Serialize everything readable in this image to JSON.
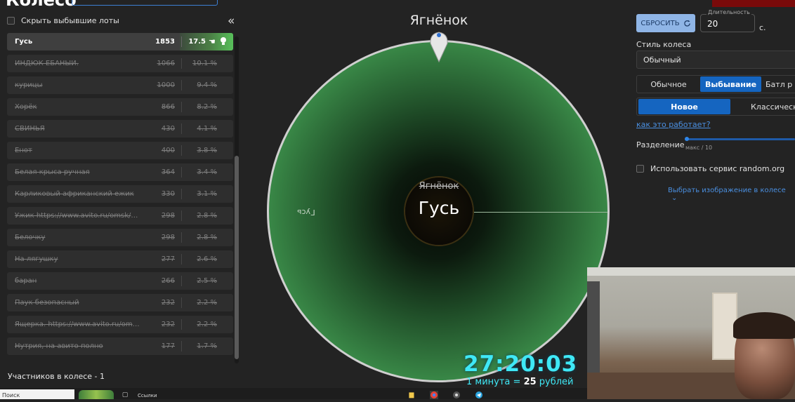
{
  "header": {
    "title": "Колесо"
  },
  "lots_panel": {
    "hide_eliminated_label": "Скрыть выбывшие лоты",
    "collapse_icon": "double-chevron-left-icon",
    "items": [
      {
        "name": "Гусь",
        "amount": "1853",
        "percent": "17.5",
        "active": true
      },
      {
        "name": "ИНДЮК ЁБАНЫЙ.",
        "amount": "1066",
        "percent": "10.1 %"
      },
      {
        "name": "курицы",
        "amount": "1000",
        "percent": "9.4 %"
      },
      {
        "name": "Хорёк",
        "amount": "866",
        "percent": "8.2 %"
      },
      {
        "name": "СВИНЬЯ",
        "amount": "430",
        "percent": "4.1 %"
      },
      {
        "name": "Енот",
        "amount": "400",
        "percent": "3.8 %"
      },
      {
        "name": "Белая крыса ручная",
        "amount": "364",
        "percent": "3.4 %"
      },
      {
        "name": "Карликовый африканский ежик",
        "amount": "330",
        "percent": "3.1 %"
      },
      {
        "name": "Ужик https://www.avito.ru/omsk/dru...",
        "amount": "298",
        "percent": "2.8 %"
      },
      {
        "name": "Белочку",
        "amount": "298",
        "percent": "2.8 %"
      },
      {
        "name": "На лягушку",
        "amount": "277",
        "percent": "2.6 %"
      },
      {
        "name": "баран",
        "amount": "266",
        "percent": "2.5 %"
      },
      {
        "name": "Паук безопасный",
        "amount": "232",
        "percent": "2.2 %"
      },
      {
        "name": "Ящерка. https://www.avito.ru/omsk/...",
        "amount": "232",
        "percent": "2.2 %"
      },
      {
        "name": "Нутрия, на авито полно",
        "amount": "177",
        "percent": "1.7 %"
      }
    ],
    "participants_label": "Участников в колесе - 1"
  },
  "wheel": {
    "winner_top": "Ягнёнок",
    "center_previous": "Ягнёнок",
    "center_current": "Гусь",
    "slice_label": "Гусь",
    "colors": {
      "slice": "#4ea35c",
      "rim": "#cfcfcf"
    }
  },
  "settings": {
    "reset_label": "СБРОСИТЬ",
    "reset_icon": "refresh-icon",
    "duration_label": "Длительность",
    "duration_value": "20",
    "duration_unit": "с.",
    "style_label": "Стиль колеса",
    "style_value": "Обычный",
    "modes": [
      "Обычное",
      "Выбывание",
      "Батл р"
    ],
    "active_mode": "Выбывание",
    "variants": [
      "Новое",
      "Классическо"
    ],
    "active_variant": "Новое",
    "how_link": "как это работает?",
    "split_label": "Разделение",
    "split_hint": "макс / 10",
    "random_org_label": "Использовать сервис random.org",
    "image_link": "Выбрать изображение в колесе"
  },
  "overlay": {
    "timer": "27:20:03",
    "rate_prefix": "1 минута = ",
    "rate_value": "25",
    "rate_suffix": " рублей"
  },
  "taskbar": {
    "search_placeholder": "Поиск",
    "item_label": "Ссылки"
  },
  "colors": {
    "accent": "#1565c0",
    "link": "#4a8fe0",
    "timer": "#3fe8f6",
    "background": "#232323"
  }
}
